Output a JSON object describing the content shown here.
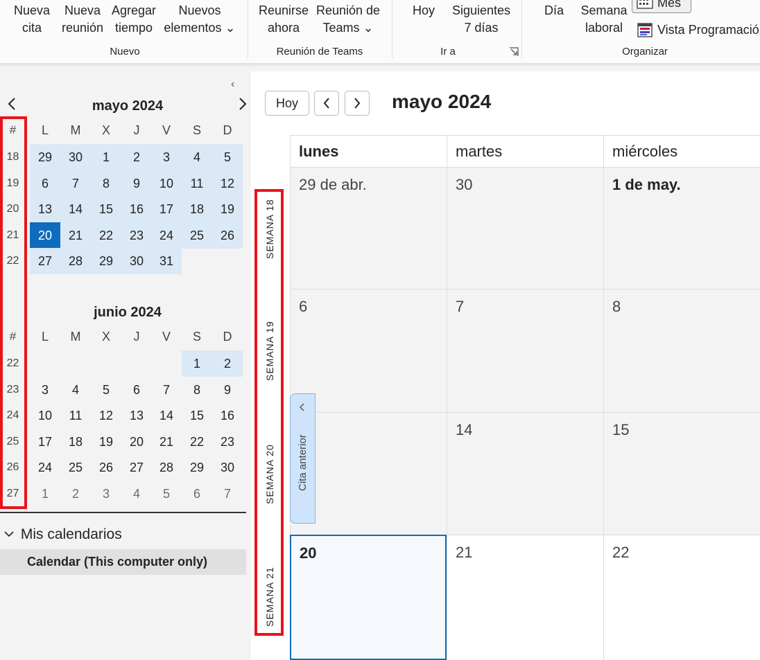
{
  "ribbon": {
    "nueva_cita": "Nueva\ncita",
    "nueva_reunion": "Nueva\nreunión",
    "agregar_tiempo": "Agregar\ntiempo",
    "nuevos_elementos": "Nuevos\nelementos ⌄",
    "reunirse_ahora": "Reunirse\nahora",
    "reunion_teams": "Reunión de\nTeams ⌄",
    "hoy": "Hoy",
    "siguientes_7": "Siguientes\n7 días",
    "dia": "Día",
    "semana_laboral": "Semana\nlaboral",
    "mes": "Mes",
    "vista_programacion": "Vista Programació",
    "groups": {
      "nuevo": "Nuevo",
      "reunion_teams": "Reunión de Teams",
      "ir_a": "Ir a",
      "organizar": "Organizar"
    }
  },
  "sidebar": {
    "collapse_glyph": "‹",
    "may": {
      "title": "mayo 2024",
      "headers": [
        "#",
        "L",
        "M",
        "X",
        "J",
        "V",
        "S",
        "D"
      ],
      "weeks": [
        {
          "num": "18",
          "days": [
            "29",
            "30",
            "1",
            "2",
            "3",
            "4",
            "5"
          ]
        },
        {
          "num": "19",
          "days": [
            "6",
            "7",
            "8",
            "9",
            "10",
            "11",
            "12"
          ]
        },
        {
          "num": "20",
          "days": [
            "13",
            "14",
            "15",
            "16",
            "17",
            "18",
            "19"
          ]
        },
        {
          "num": "21",
          "days": [
            "20",
            "21",
            "22",
            "23",
            "24",
            "25",
            "26"
          ]
        },
        {
          "num": "22",
          "days": [
            "27",
            "28",
            "29",
            "30",
            "31",
            "",
            ""
          ]
        }
      ]
    },
    "june": {
      "title": "junio 2024",
      "headers": [
        "#",
        "L",
        "M",
        "X",
        "J",
        "V",
        "S",
        "D"
      ],
      "weeks": [
        {
          "num": "22",
          "days": [
            "",
            "",
            "",
            "",
            "",
            "1",
            "2"
          ]
        },
        {
          "num": "23",
          "days": [
            "3",
            "4",
            "5",
            "6",
            "7",
            "8",
            "9"
          ]
        },
        {
          "num": "24",
          "days": [
            "10",
            "11",
            "12",
            "13",
            "14",
            "15",
            "16"
          ]
        },
        {
          "num": "25",
          "days": [
            "17",
            "18",
            "19",
            "20",
            "21",
            "22",
            "23"
          ]
        },
        {
          "num": "26",
          "days": [
            "24",
            "25",
            "26",
            "27",
            "28",
            "29",
            "30"
          ]
        },
        {
          "num": "27",
          "days": [
            "1",
            "2",
            "3",
            "4",
            "5",
            "6",
            "7"
          ]
        }
      ]
    },
    "mis_calendarios": "Mis calendarios",
    "calendar_item": "Calendar (This computer only)"
  },
  "main": {
    "hoy_button": "Hoy",
    "prev_glyph": "‹",
    "next_glyph": "›",
    "title": "mayo 2024",
    "columns": [
      "lunes",
      "martes",
      "miércoles"
    ],
    "weeks": [
      {
        "label": "SEMANA 18",
        "days": [
          "29 de abr.",
          "30",
          "1 de may."
        ]
      },
      {
        "label": "SEMANA 19",
        "days": [
          "6",
          "7",
          "8"
        ]
      },
      {
        "label": "SEMANA 20",
        "days": [
          "",
          "14",
          "15"
        ]
      },
      {
        "label": "SEMANA 21",
        "days": [
          "20",
          "21",
          "22"
        ]
      }
    ],
    "prev_appointment": "Cita anterior"
  }
}
